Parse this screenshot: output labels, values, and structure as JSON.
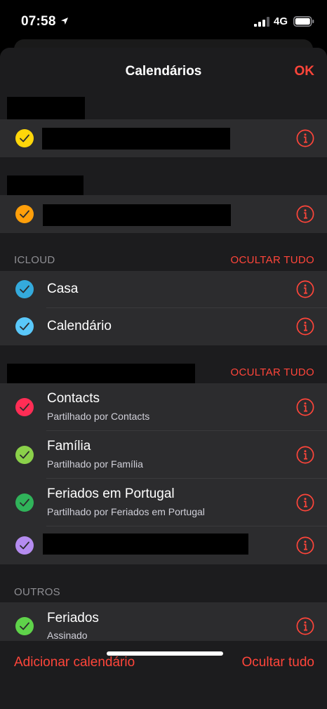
{
  "status_bar": {
    "time": "07:58",
    "network": "4G"
  },
  "nav": {
    "title": "Calendários",
    "done_label": "OK"
  },
  "sections": [
    {
      "label": "",
      "action": "",
      "rows": [
        {
          "title": "",
          "subtitle": "",
          "color": "#ffd60a"
        }
      ]
    },
    {
      "label": "",
      "action": "",
      "rows": [
        {
          "title": "",
          "subtitle": "",
          "color": "#ff9f0a"
        }
      ]
    },
    {
      "label": "ICLOUD",
      "action": "OCULTAR TUDO",
      "rows": [
        {
          "title": "Casa",
          "subtitle": "",
          "color": "#34aadc"
        },
        {
          "title": "Calendário",
          "subtitle": "",
          "color": "#5ac8fa"
        }
      ]
    },
    {
      "label": "",
      "action": "OCULTAR TUDO",
      "rows": [
        {
          "title": "Contacts",
          "subtitle": "Partilhado por Contacts",
          "color": "#ff2d55"
        },
        {
          "title": "Família",
          "subtitle": "Partilhado por Família",
          "color": "#8bd14a"
        },
        {
          "title": "Feriados em Portugal",
          "subtitle": "Partilhado por Feriados em Portugal",
          "color": "#30b35a"
        },
        {
          "title": "",
          "subtitle": "",
          "color": "#b58cf0"
        }
      ]
    },
    {
      "label": "OUTROS",
      "action": "",
      "rows": [
        {
          "title": "Feriados",
          "subtitle": "Assinado",
          "color": "#5fd34a"
        }
      ]
    }
  ],
  "toolbar": {
    "add_calendar": "Adicionar calendário",
    "hide_all": "Ocultar tudo"
  },
  "colors": {
    "accent": "#ff453a",
    "background": "#1c1c1e",
    "row": "#2c2c2e"
  }
}
